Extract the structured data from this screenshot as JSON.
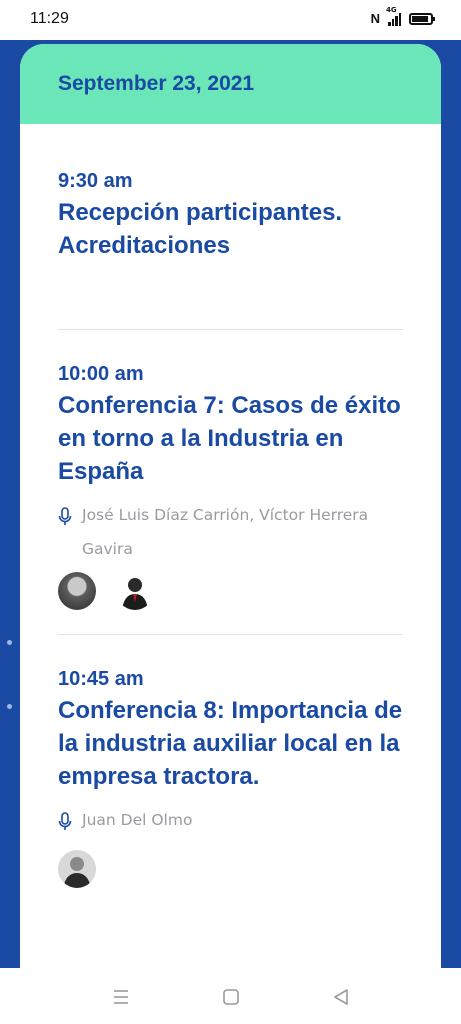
{
  "status_bar": {
    "time": "11:29",
    "nfc": "N",
    "network": "4G"
  },
  "schedule": {
    "date": "September 23, 2021",
    "sessions": [
      {
        "time": "9:30 am",
        "title": "Recepción participantes. Acreditaciones"
      },
      {
        "time": "10:00 am",
        "title": "Conferencia 7: Casos de éxito en torno a la Industria en España",
        "speakers": "José Luis Díaz Carrión, Víctor Herrera Gavira"
      },
      {
        "time": "10:45 am",
        "title": "Conferencia 8: Importancia de la industria auxiliar local en la empresa tractora.",
        "speakers": "Juan Del Olmo"
      }
    ]
  },
  "icons": {
    "speaker": "microphone-icon",
    "recents": "recents-icon",
    "home": "home-icon",
    "back": "back-icon"
  },
  "colors": {
    "primary": "#1a4aa3",
    "header": "#6be6b8",
    "muted": "#9a9aa0"
  }
}
